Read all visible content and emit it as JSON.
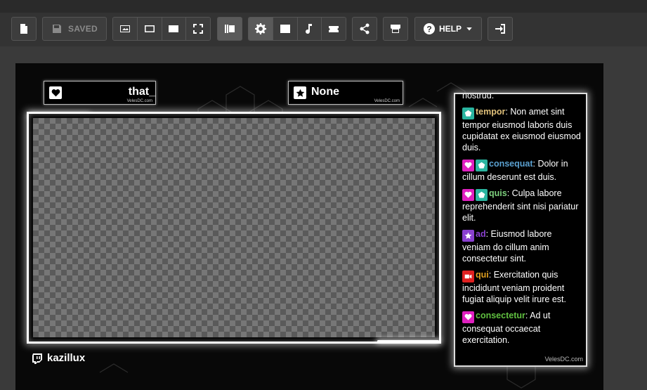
{
  "toolbar": {
    "saved_label": "SAVED",
    "help_label": "HELP",
    "icons": [
      "file-icon",
      "save-icon",
      "image-layout-icon",
      "crop-icon",
      "image-icon",
      "fullscreen-icon",
      "library-icon",
      "gear-icon",
      "picture-icon",
      "music-icon",
      "ticket-icon",
      "share-icon",
      "store-icon",
      "help-icon",
      "logout-icon"
    ]
  },
  "overlay": {
    "name_box_left": "that_",
    "name_box_right": "None",
    "name_watermark": "VelesDC.com",
    "twitch_user": "kazillux",
    "chat_watermark": "VelesDC.com",
    "chat": [
      {
        "badges": [],
        "user": "",
        "text": "nostrud.",
        "color": "#ffffff"
      },
      {
        "badges": [
          "pentagon-teal"
        ],
        "user": "tempor",
        "text": ": Non amet sint tempor eiusmod laboris duis cupidatat ex eiusmod eiusmod duis.",
        "color": "#e0c07a"
      },
      {
        "badges": [
          "heart-magenta",
          "pentagon-teal"
        ],
        "user": "consequat",
        "text": ": Dolor in cillum deserunt est duis.",
        "color": "#5aa0d0"
      },
      {
        "badges": [
          "heart-magenta",
          "pentagon-teal"
        ],
        "user": "quis",
        "text": ": Culpa labore reprehenderit sint nisi pariatur elit.",
        "color": "#7ed07e"
      },
      {
        "badges": [
          "star-purple"
        ],
        "user": "ad",
        "text": ": Eiusmod labore veniam do cillum anim consectetur sint.",
        "color": "#8a40d0"
      },
      {
        "badges": [
          "video-red"
        ],
        "user": "qui",
        "text": ": Exercitation quis incididunt veniam proident fugiat aliquip velit irure est.",
        "color": "#e0a020"
      },
      {
        "badges": [
          "heart-magenta"
        ],
        "user": "consectetur",
        "text": ": Ad ut consequat occaecat exercitation.",
        "color": "#60c040"
      }
    ]
  }
}
